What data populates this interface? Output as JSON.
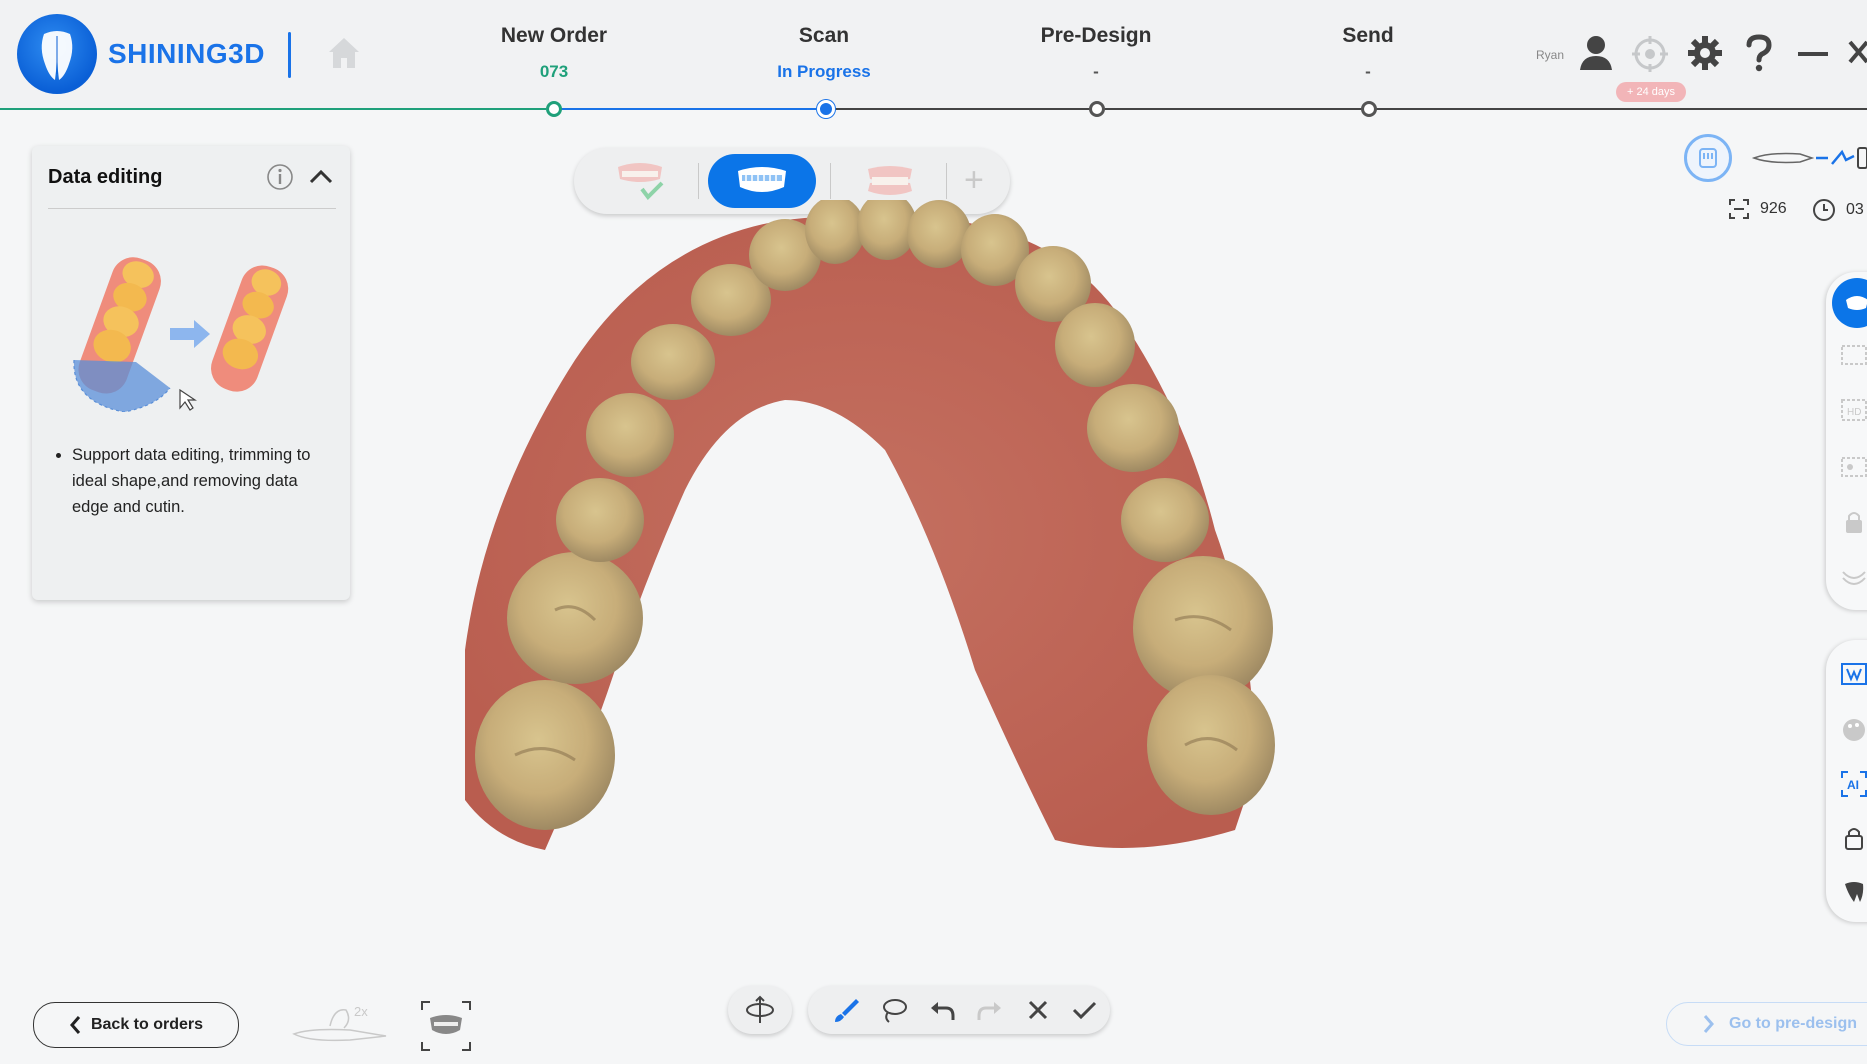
{
  "app": {
    "brand": "SHINING3D",
    "user_name": "Ryan",
    "license_badge": "+ 24 days"
  },
  "steps": [
    {
      "title": "New Order",
      "status": "073"
    },
    {
      "title": "Scan",
      "status": "In Progress"
    },
    {
      "title": "Pre-Design",
      "status": "-"
    },
    {
      "title": "Send",
      "status": "-"
    }
  ],
  "panel": {
    "title": "Data editing",
    "bullet": "Support data editing, trimming to ideal shape,and removing data edge and cutin."
  },
  "stats": {
    "frames": "926",
    "time": "03"
  },
  "bottom": {
    "back_label": "Back to orders",
    "predesign_label": "Go to pre-design",
    "speed_label": "2x"
  },
  "icons": {
    "home": "home-icon",
    "user": "user-icon",
    "calibrate": "crosshair-icon",
    "settings": "gear-icon",
    "help": "question-icon",
    "minimize": "minimize-icon",
    "close": "close-icon"
  },
  "colors": {
    "accent": "#1a73e8",
    "done_green": "#1fa07a",
    "badge_pink": "#f2b5b8"
  }
}
